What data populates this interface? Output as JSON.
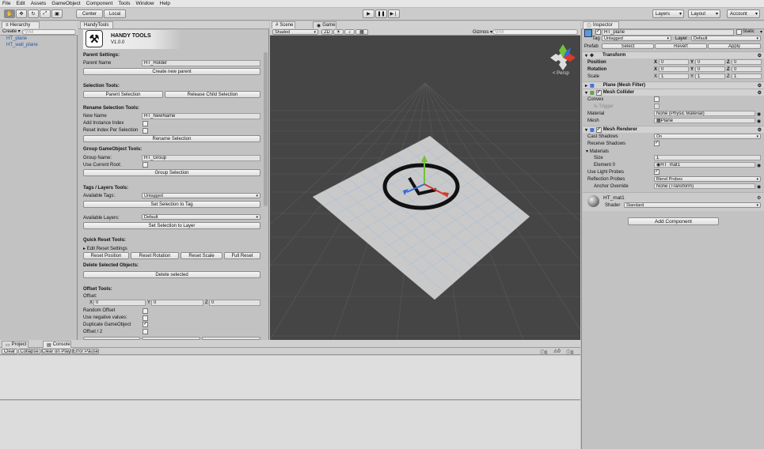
{
  "menu": [
    "File",
    "Edit",
    "Assets",
    "GameObject",
    "Component",
    "Tools",
    "Window",
    "Help"
  ],
  "toolbar": {
    "pivot": "Center",
    "space": "Local",
    "layers": "Layers",
    "layout": "Layout",
    "account": "Account"
  },
  "hierarchy": {
    "tab": "Hierarchy",
    "create": "Create",
    "search": "All",
    "items": [
      "HT_plane",
      "HT_wall_plane"
    ]
  },
  "handy": {
    "tab": "HandyTools",
    "title": "HANDY TOOLS",
    "version": "V1.0.0",
    "parent_settings": "Parent Settings:",
    "parent_name_label": "Parent Name",
    "parent_name_value": "HT_Holder",
    "create_parent": "Create new parent",
    "selection_tools": "Selection Tools:",
    "parent_selection": "Parent Selection",
    "release_child": "Release Child Selection",
    "rename_tools": "Rename Selection Tools:",
    "new_name_label": "New Name",
    "new_name_value": "HT_NewName",
    "add_index": "Add Instance Index",
    "reset_index": "Reset Index Per Selection",
    "rename_btn": "Rename Selection",
    "group_tools": "Group GameObject Tools:",
    "group_name_label": "Group Name:",
    "group_name_value": "HT_Group",
    "use_root": "Use Current Root:",
    "group_btn": "Group Selection",
    "tags_tools": "Tags / Layers Tools:",
    "avail_tags": "Available Tags:",
    "tag_value": "Untagged",
    "set_tag": "Set Selection to Tag",
    "avail_layers": "Available Layers:",
    "layer_value": "Default",
    "set_layer": "Set Selection to Layer",
    "quick_reset": "Quick Reset Tools:",
    "edit_reset": "Edit Reset Settings",
    "reset_position": "Reset Position",
    "reset_rotation": "Reset Rotation",
    "reset_scale": "Reset Scale",
    "full_reset": "Full Reset",
    "delete_tools": "Delete Selected Objects:",
    "delete_btn": "Delete selected",
    "offset_tools": "Offset Tools:",
    "offset_label": "Offset:",
    "x": "X",
    "x_val": "0",
    "y": "Y",
    "y_val": "0",
    "z": "Z",
    "z_val": "0",
    "random_offset": "Random Offset",
    "use_negative": "Use negative values:",
    "duplicate": "Duplicate GameObject",
    "offset_half": "Offset / 2"
  },
  "scene": {
    "tab_scene": "Scene",
    "tab_game": "Game",
    "shading": "Shaded",
    "mode2d": "2D",
    "gizmos": "Gizmos",
    "search": "All",
    "persp": "< Persp"
  },
  "bottom": {
    "tab_project": "Project",
    "tab_console": "Console",
    "clear": "Clear",
    "collapse": "Collapse",
    "clear_on_play": "Clear on Play",
    "error_pause": "Error Pause",
    "c1": "0",
    "c2": "0",
    "c3": "0"
  },
  "inspector": {
    "tab": "Inspector",
    "name": "HT_plane",
    "static": "Static",
    "tag_label": "Tag",
    "tag": "Untagged",
    "layer_label": "Layer",
    "layer": "Default",
    "prefab_label": "Prefab",
    "select": "Select",
    "revert": "Revert",
    "apply": "Apply",
    "transform": "Transform",
    "position": "Position",
    "rotation": "Rotation",
    "scale": "Scale",
    "pos": [
      "0",
      "0",
      "0"
    ],
    "rot": [
      "0",
      "0",
      "0"
    ],
    "scl": [
      "1",
      "1",
      "1"
    ],
    "mesh_filter": "Plane (Mesh Filter)",
    "mesh_collider": "Mesh Collider",
    "convex": "Convex",
    "is_trigger": "Is Trigger",
    "material_label": "Material",
    "material_value": "None (Physic Material)",
    "mesh_label": "Mesh",
    "mesh_value": "Plane",
    "mesh_renderer": "Mesh Renderer",
    "cast_shadows": "Cast Shadows",
    "cast_value": "On",
    "receive_shadows": "Receive Shadows",
    "materials": "Materials",
    "size_label": "Size",
    "size_value": "1",
    "element0": "Element 0",
    "element0_value": "HT_mat1",
    "light_probes": "Use Light Probes",
    "reflection_probes": "Reflection Probes",
    "reflection_value": "Blend Probes",
    "anchor_override": "Anchor Override",
    "anchor_value": "None (Transform)",
    "mat_name": "HT_mat1",
    "shader_label": "Shader",
    "shader_value": "Standard",
    "add_component": "Add Component"
  }
}
